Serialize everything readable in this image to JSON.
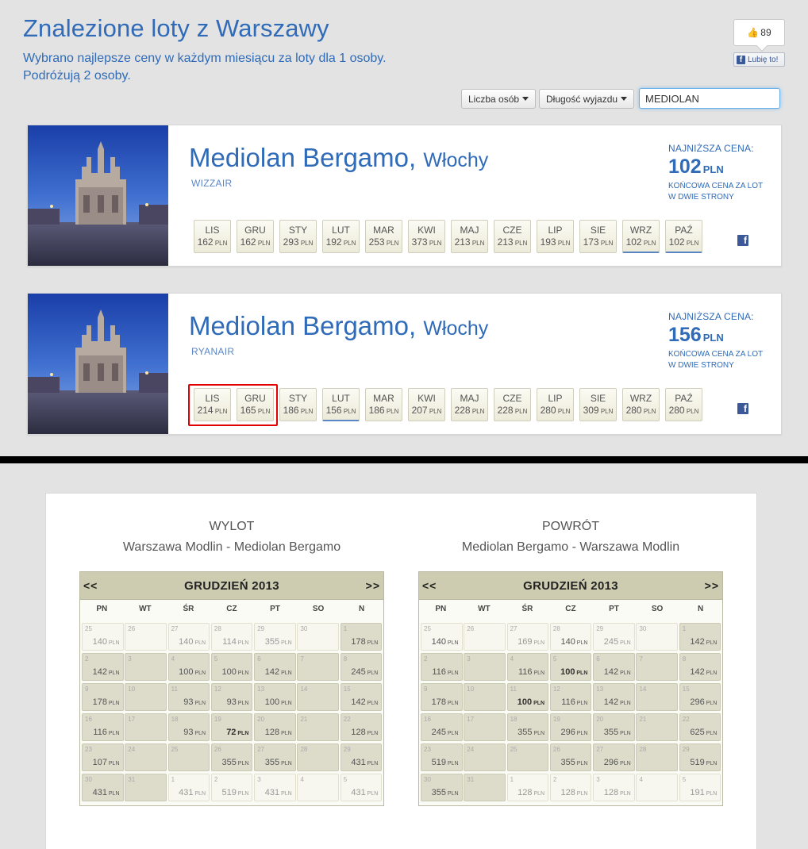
{
  "header": {
    "title": "Znalezione loty z Warszawy",
    "subtitle_line1": "Wybrano najlepsze ceny w każdym miesiącu za loty dla 1 osoby.",
    "subtitle_line2": "Podróżują 2 osoby."
  },
  "facebook": {
    "like_count": "89",
    "like_label": "Lubię to!"
  },
  "filters": {
    "persons_label": "Liczba osób",
    "duration_label": "Długość wyjazdu",
    "search_value": "MEDIOLAN"
  },
  "results": [
    {
      "city": "Mediolan Bergamo,",
      "country": "Włochy",
      "airline": "WIZZAIR",
      "lowest_label": "NAJNIŻSZA CENA:",
      "lowest_price": "102",
      "currency": "PLN",
      "note": "KOŃCOWA CENA ZA LOT W DWIE STRONY",
      "months": [
        {
          "m": "LIS",
          "p": "162"
        },
        {
          "m": "GRU",
          "p": "162"
        },
        {
          "m": "STY",
          "p": "293"
        },
        {
          "m": "LUT",
          "p": "192"
        },
        {
          "m": "MAR",
          "p": "253"
        },
        {
          "m": "KWI",
          "p": "373"
        },
        {
          "m": "MAJ",
          "p": "213"
        },
        {
          "m": "CZE",
          "p": "213"
        },
        {
          "m": "LIP",
          "p": "193"
        },
        {
          "m": "SIE",
          "p": "173"
        },
        {
          "m": "WRZ",
          "p": "102"
        },
        {
          "m": "PAŹ",
          "p": "102"
        }
      ],
      "active_months": [
        10,
        11
      ]
    },
    {
      "city": "Mediolan Bergamo,",
      "country": "Włochy",
      "airline": "RYANAIR",
      "lowest_label": "NAJNIŻSZA CENA:",
      "lowest_price": "156",
      "currency": "PLN",
      "note": "KOŃCOWA CENA ZA LOT W DWIE STRONY",
      "months": [
        {
          "m": "LIS",
          "p": "214"
        },
        {
          "m": "GRU",
          "p": "165"
        },
        {
          "m": "STY",
          "p": "186"
        },
        {
          "m": "LUT",
          "p": "156"
        },
        {
          "m": "MAR",
          "p": "186"
        },
        {
          "m": "KWI",
          "p": "207"
        },
        {
          "m": "MAJ",
          "p": "228"
        },
        {
          "m": "CZE",
          "p": "228"
        },
        {
          "m": "LIP",
          "p": "280"
        },
        {
          "m": "SIE",
          "p": "309"
        },
        {
          "m": "WRZ",
          "p": "280"
        },
        {
          "m": "PAŹ",
          "p": "280"
        }
      ],
      "active_months": [
        3
      ]
    }
  ],
  "calendars": [
    {
      "title": "WYLOT",
      "route": "Warszawa Modlin - Mediolan Bergamo",
      "prev": "<<",
      "next": ">>",
      "month": "GRUDZIEŃ 2013",
      "days": [
        "PN",
        "WT",
        "ŚR",
        "CZ",
        "PT",
        "SO",
        "N"
      ],
      "cells": [
        {
          "d": "25",
          "p": "140",
          "s": "muted"
        },
        {
          "d": "26",
          "p": "",
          "s": "muted"
        },
        {
          "d": "27",
          "p": "140",
          "s": "muted"
        },
        {
          "d": "28",
          "p": "114",
          "s": "muted"
        },
        {
          "d": "29",
          "p": "355",
          "s": "muted"
        },
        {
          "d": "30",
          "p": "",
          "s": "muted"
        },
        {
          "d": "1",
          "p": "178",
          "s": "dark"
        },
        {
          "d": "2",
          "p": "142",
          "s": "dark"
        },
        {
          "d": "3",
          "p": "",
          "s": "dark"
        },
        {
          "d": "4",
          "p": "100",
          "s": "dark"
        },
        {
          "d": "5",
          "p": "100",
          "s": "dark"
        },
        {
          "d": "6",
          "p": "142",
          "s": "dark"
        },
        {
          "d": "7",
          "p": "",
          "s": "dark"
        },
        {
          "d": "8",
          "p": "245",
          "s": "dark"
        },
        {
          "d": "9",
          "p": "178",
          "s": "dark"
        },
        {
          "d": "10",
          "p": "",
          "s": "dark"
        },
        {
          "d": "11",
          "p": "93",
          "s": "dark"
        },
        {
          "d": "12",
          "p": "93",
          "s": "dark"
        },
        {
          "d": "13",
          "p": "100",
          "s": "dark"
        },
        {
          "d": "14",
          "p": "",
          "s": "dark"
        },
        {
          "d": "15",
          "p": "142",
          "s": "dark"
        },
        {
          "d": "16",
          "p": "116",
          "s": "dark"
        },
        {
          "d": "17",
          "p": "",
          "s": "dark"
        },
        {
          "d": "18",
          "p": "93",
          "s": "dark"
        },
        {
          "d": "19",
          "p": "72",
          "s": "bold"
        },
        {
          "d": "20",
          "p": "128",
          "s": "dark"
        },
        {
          "d": "21",
          "p": "",
          "s": "dark"
        },
        {
          "d": "22",
          "p": "128",
          "s": "dark"
        },
        {
          "d": "23",
          "p": "107",
          "s": "dark"
        },
        {
          "d": "24",
          "p": "",
          "s": "dark"
        },
        {
          "d": "25",
          "p": "",
          "s": "dark"
        },
        {
          "d": "26",
          "p": "355",
          "s": "dark"
        },
        {
          "d": "27",
          "p": "355",
          "s": "dark"
        },
        {
          "d": "28",
          "p": "",
          "s": "dark"
        },
        {
          "d": "29",
          "p": "431",
          "s": "dark"
        },
        {
          "d": "30",
          "p": "431",
          "s": "dark"
        },
        {
          "d": "31",
          "p": "",
          "s": "dark"
        },
        {
          "d": "1",
          "p": "431",
          "s": "muted"
        },
        {
          "d": "2",
          "p": "519",
          "s": "muted"
        },
        {
          "d": "3",
          "p": "431",
          "s": "muted"
        },
        {
          "d": "4",
          "p": "",
          "s": "muted"
        },
        {
          "d": "5",
          "p": "431",
          "s": "muted"
        }
      ]
    },
    {
      "title": "POWRÓT",
      "route": "Mediolan Bergamo - Warszawa Modlin",
      "prev": "<<",
      "next": ">>",
      "month": "GRUDZIEŃ 2013",
      "days": [
        "PN",
        "WT",
        "ŚR",
        "CZ",
        "PT",
        "SO",
        "N"
      ],
      "cells": [
        {
          "d": "25",
          "p": "140",
          "s": "muted2"
        },
        {
          "d": "26",
          "p": "",
          "s": "muted"
        },
        {
          "d": "27",
          "p": "169",
          "s": "muted"
        },
        {
          "d": "28",
          "p": "140",
          "s": "muted2"
        },
        {
          "d": "29",
          "p": "245",
          "s": "muted"
        },
        {
          "d": "30",
          "p": "",
          "s": "muted"
        },
        {
          "d": "1",
          "p": "142",
          "s": "dark"
        },
        {
          "d": "2",
          "p": "116",
          "s": "dark"
        },
        {
          "d": "3",
          "p": "",
          "s": "dark"
        },
        {
          "d": "4",
          "p": "116",
          "s": "dark"
        },
        {
          "d": "5",
          "p": "100",
          "s": "bold"
        },
        {
          "d": "6",
          "p": "142",
          "s": "dark"
        },
        {
          "d": "7",
          "p": "",
          "s": "dark"
        },
        {
          "d": "8",
          "p": "142",
          "s": "dark"
        },
        {
          "d": "9",
          "p": "178",
          "s": "dark"
        },
        {
          "d": "10",
          "p": "",
          "s": "dark"
        },
        {
          "d": "11",
          "p": "100",
          "s": "bold"
        },
        {
          "d": "12",
          "p": "116",
          "s": "dark"
        },
        {
          "d": "13",
          "p": "142",
          "s": "dark"
        },
        {
          "d": "14",
          "p": "",
          "s": "dark"
        },
        {
          "d": "15",
          "p": "296",
          "s": "dark"
        },
        {
          "d": "16",
          "p": "245",
          "s": "dark"
        },
        {
          "d": "17",
          "p": "",
          "s": "dark"
        },
        {
          "d": "18",
          "p": "355",
          "s": "dark"
        },
        {
          "d": "19",
          "p": "296",
          "s": "dark"
        },
        {
          "d": "20",
          "p": "355",
          "s": "dark"
        },
        {
          "d": "21",
          "p": "",
          "s": "dark"
        },
        {
          "d": "22",
          "p": "625",
          "s": "dark"
        },
        {
          "d": "23",
          "p": "519",
          "s": "dark"
        },
        {
          "d": "24",
          "p": "",
          "s": "dark"
        },
        {
          "d": "25",
          "p": "",
          "s": "dark"
        },
        {
          "d": "26",
          "p": "355",
          "s": "dark"
        },
        {
          "d": "27",
          "p": "296",
          "s": "dark"
        },
        {
          "d": "28",
          "p": "",
          "s": "dark"
        },
        {
          "d": "29",
          "p": "519",
          "s": "dark"
        },
        {
          "d": "30",
          "p": "355",
          "s": "dark"
        },
        {
          "d": "31",
          "p": "",
          "s": "dark"
        },
        {
          "d": "1",
          "p": "128",
          "s": "muted"
        },
        {
          "d": "2",
          "p": "128",
          "s": "muted"
        },
        {
          "d": "3",
          "p": "128",
          "s": "muted"
        },
        {
          "d": "4",
          "p": "",
          "s": "muted"
        },
        {
          "d": "5",
          "p": "191",
          "s": "muted"
        }
      ]
    }
  ],
  "colors": {
    "brand_blue": "#2f6bb8",
    "highlight_red": "#e20000",
    "facebook": "#3b5998",
    "calendar_header": "#cdccb0"
  }
}
